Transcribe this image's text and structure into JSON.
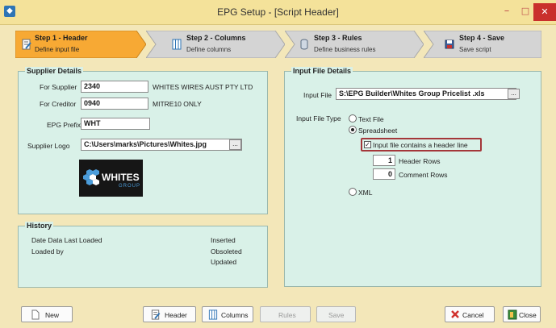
{
  "window": {
    "title": "EPG Setup - [Script Header]"
  },
  "steps": [
    {
      "title": "Step 1 - Header",
      "subtitle": "Define input file",
      "state": "active"
    },
    {
      "title": "Step 2 - Columns",
      "subtitle": "Define columns",
      "state": "inactive"
    },
    {
      "title": "Step 3 - Rules",
      "subtitle": "Define business rules",
      "state": "inactive"
    },
    {
      "title": "Step 4 - Save",
      "subtitle": "Save script",
      "state": "inactive"
    }
  ],
  "supplier": {
    "panel_title": "Supplier Details",
    "for_supplier_label": "For Supplier",
    "for_supplier_value": "2340",
    "for_supplier_name": "WHITES WIRES AUST PTY LTD",
    "for_creditor_label": "For Creditor",
    "for_creditor_value": "0940",
    "for_creditor_name": "MITRE10 ONLY",
    "epg_prefix_label": "EPG Prefix",
    "epg_prefix_value": "WHT",
    "logo_label": "Supplier Logo",
    "logo_path": "C:\\Users\\marks\\Pictures\\Whites.jpg",
    "browse_label": "...",
    "logo_text": "WHITES",
    "logo_subtext": "GROUP"
  },
  "history": {
    "panel_title": "History",
    "date_loaded_label": "Date Data Last Loaded",
    "loaded_by_label": "Loaded by",
    "inserted_label": "Inserted",
    "obsoleted_label": "Obsoleted",
    "updated_label": "Updated"
  },
  "input_file": {
    "panel_title": "Input File Details",
    "file_label": "Input File",
    "file_path": "S:\\EPG Builder\\Whites Group Pricelist .xls",
    "browse_label": "...",
    "type_label": "Input File Type",
    "options": [
      "Text File",
      "Spreadsheet",
      "XML"
    ],
    "selected": "Spreadsheet",
    "header_line_label": "Input file contains a header line",
    "header_line_checked": true,
    "header_rows_value": "1",
    "header_rows_label": "Header Rows",
    "comment_rows_value": "0",
    "comment_rows_label": "Comment Rows"
  },
  "buttons": {
    "new": "New",
    "header": "Header",
    "columns": "Columns",
    "rules": "Rules",
    "save": "Save",
    "cancel": "Cancel",
    "close": "Close"
  },
  "colors": {
    "active_step": "#f7a934",
    "inactive_step": "#d4d4d4",
    "panel_bg": "#d9f1e8",
    "window_bg": "#f3e7b9",
    "close_button": "#c9302c",
    "highlight_border": "#a4373a"
  }
}
